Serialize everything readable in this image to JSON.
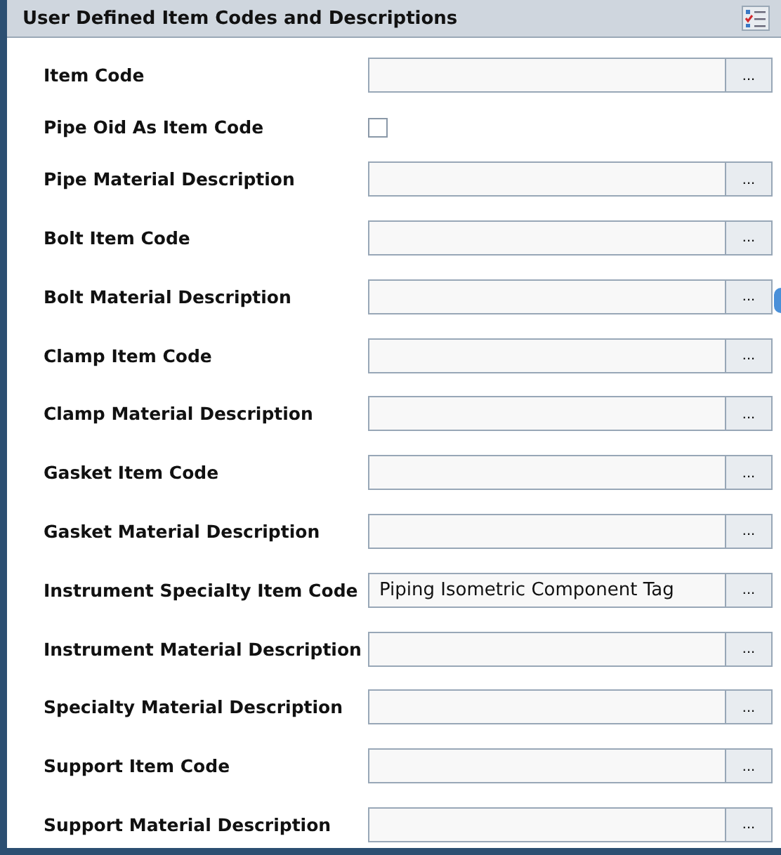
{
  "panel": {
    "title": "User Defined Item Codes and Descriptions"
  },
  "properties": [
    {
      "kind": "field",
      "label": "Item Code",
      "button": "..."
    },
    {
      "kind": "checkbox",
      "label": "Pipe Oid As Item Code",
      "checked": false
    },
    {
      "kind": "field",
      "label": "Pipe Material Description",
      "button": "..."
    },
    {
      "kind": "field",
      "label": "Bolt Item Code",
      "button": "..."
    },
    {
      "kind": "field",
      "label": "Bolt Material Description",
      "button": "..."
    },
    {
      "kind": "field",
      "label": "Clamp Item Code",
      "button": "..."
    },
    {
      "kind": "field",
      "label": "Clamp Material Description",
      "button": "..."
    },
    {
      "kind": "field",
      "label": "Gasket Item Code",
      "button": "..."
    },
    {
      "kind": "field",
      "label": "Gasket Material Description",
      "button": "..."
    },
    {
      "kind": "field",
      "label": "Instrument Specialty Item Code",
      "value": "Piping Isometric Component Tag",
      "button": "..."
    },
    {
      "kind": "field",
      "label": "Instrument Material Description",
      "button": "..."
    },
    {
      "kind": "field",
      "label": "Specialty Material Description",
      "button": "..."
    },
    {
      "kind": "field",
      "label": "Support Item Code",
      "button": "..."
    },
    {
      "kind": "field",
      "label": "Support Material Description",
      "button": "..."
    }
  ]
}
